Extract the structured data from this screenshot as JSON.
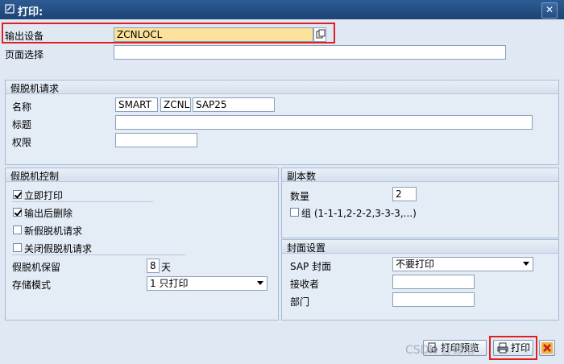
{
  "window": {
    "title": "打印:",
    "close_icon": "close-x-icon"
  },
  "top": {
    "output_device_label": "输出设备",
    "output_device_value": "ZCNLOCL",
    "page_selection_label": "页面选择",
    "page_selection_value": ""
  },
  "spool_request": {
    "title": "假脱机请求",
    "name_label": "名称",
    "name_values": [
      "SMART",
      "ZCNL",
      "SAP25"
    ],
    "title_label": "标题",
    "title_value": "",
    "authority_label": "权限",
    "authority_value": ""
  },
  "spool_control": {
    "title": "假脱机控制",
    "print_immediately": {
      "label": "立即打印",
      "checked": true
    },
    "delete_after_output": {
      "label": "输出后删除",
      "checked": true
    },
    "new_spool_request": {
      "label": "新假脱机请求",
      "checked": false
    },
    "close_spool_request": {
      "label": "关闭假脱机请求",
      "checked": false
    },
    "retention_label": "假脱机保留",
    "retention_value": "8",
    "retention_unit": "天",
    "storage_mode_label": "存储模式",
    "storage_mode_value": "1 只打印"
  },
  "copies": {
    "title": "副本数",
    "quantity_label": "数量",
    "quantity_value": "2",
    "group_label": "组 (1-1-1,2-2-2,3-3-3,...)",
    "group_checked": false
  },
  "cover_page": {
    "title": "封面设置",
    "sap_cover_label": "SAP 封面",
    "sap_cover_value": "不要打印",
    "recipient_label": "接收者",
    "recipient_value": "",
    "department_label": "部门",
    "department_value": ""
  },
  "buttons": {
    "print_preview_label": "打印预览",
    "print_label": "打印",
    "cancel_icon": "cancel-x-icon"
  },
  "watermark": "CSDN @鲸落"
}
